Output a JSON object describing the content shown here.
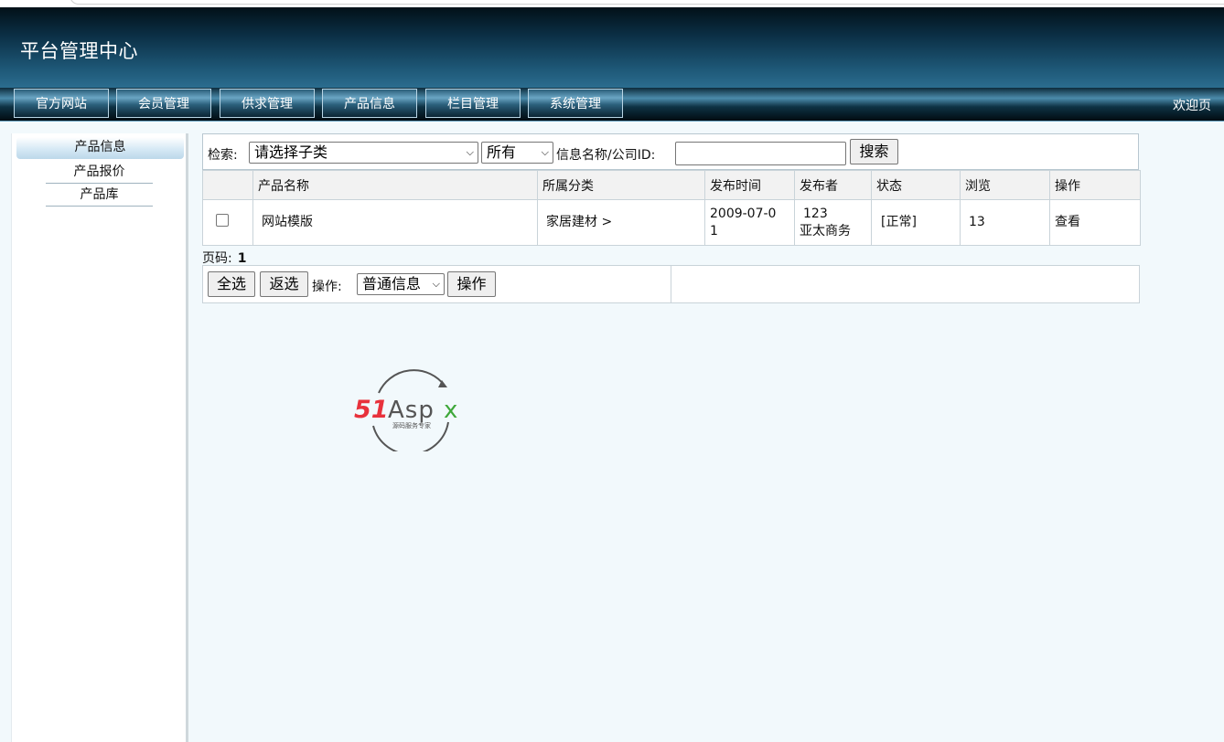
{
  "header": {
    "title": "平台管理中心"
  },
  "nav": {
    "tabs": [
      "官方网站",
      "会员管理",
      "供求管理",
      "产品信息",
      "栏目管理",
      "系统管理"
    ],
    "welcome": "欢迎页"
  },
  "sidebar": {
    "heading": "产品信息",
    "items": [
      "产品报价",
      "产品库"
    ]
  },
  "search": {
    "label": "检索:",
    "category_select": "请选择子类",
    "scope_select": "所有",
    "name_label": "信息名称/公司ID:",
    "input_value": "",
    "button": "搜索"
  },
  "table": {
    "headers": [
      "",
      "产品名称",
      "所属分类",
      "发布时间",
      "发布者",
      "状态",
      "浏览",
      "操作"
    ],
    "rows": [
      {
        "name": "网站模版",
        "category": "家居建材 >",
        "date": " 2009-07-01",
        "publisher_id": "123",
        "publisher_name": "亚太商务",
        "status": "[正常]",
        "views": "13",
        "action": "查看"
      }
    ]
  },
  "pager": {
    "label": "页码:",
    "page": "1"
  },
  "actions": {
    "select_all": "全选",
    "invert": "返选",
    "op_label": "操作:",
    "op_select": "普通信息",
    "op_button": "操作"
  },
  "logo": {
    "text": "51Aspx",
    "tagline": "源码服务专家"
  },
  "colors": {
    "header_dark": "#0b2f45",
    "header_light": "#2b6d8f",
    "page_bg": "#f2f9fc",
    "logo_red": "#e8323c",
    "logo_green": "#3fa83a"
  }
}
